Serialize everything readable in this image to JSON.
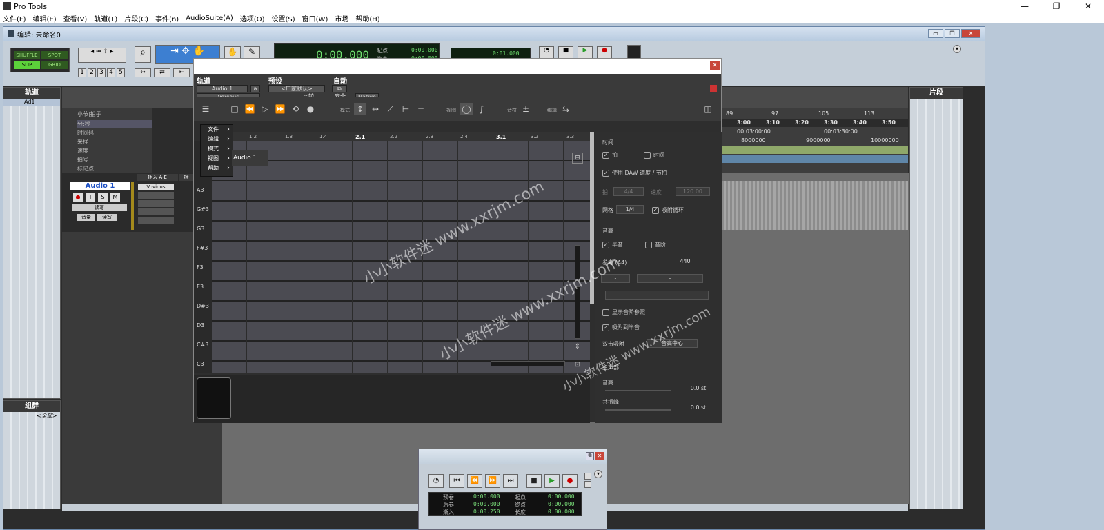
{
  "os": {
    "app_title": "Pro Tools",
    "window_controls": [
      "—",
      "❐",
      "✕"
    ]
  },
  "menu": [
    "文件(F)",
    "编辑(E)",
    "查看(V)",
    "轨道(T)",
    "片段(C)",
    "事件(n)",
    "AudioSuite(A)",
    "选项(O)",
    "设置(S)",
    "窗口(W)",
    "市场",
    "帮助(H)"
  ],
  "edit_window": {
    "title": "编辑: 未命名0",
    "modes": {
      "shuffle": "SHUFFLE",
      "spot": "SPOT",
      "slip": "SLIP",
      "grid": "GRID"
    },
    "zoom_presets": [
      "1",
      "2",
      "3",
      "4",
      "5"
    ],
    "counter_main": "0:00.000",
    "counter_start_label": "起点",
    "counter_start": "0:00.000",
    "counter_end_label": "终点",
    "counter_end": "0:00.000",
    "small_counter": "0:01.000"
  },
  "tracks_panel": {
    "title": "轨道",
    "items": [
      "Ad1"
    ]
  },
  "groups_panel": {
    "title": "组群",
    "items": [
      "<全部>"
    ]
  },
  "clips_panel": {
    "title": "片段"
  },
  "rulers": [
    "小节|拍子",
    "分:秒",
    "时间码",
    "采样",
    "速度",
    "拍号",
    "标记点"
  ],
  "ruler_bars": [
    "89",
    "97",
    "105",
    "113"
  ],
  "ruler_minsec": [
    "3:00",
    "3:10",
    "3:20",
    "3:30",
    "3:40",
    "3:50"
  ],
  "ruler_timecode": [
    "00:03:00:00",
    "00:03:30:00"
  ],
  "ruler_samples": [
    "8000000",
    "9000000",
    "10000000"
  ],
  "track": {
    "name": "Audio 1",
    "buttons": [
      "●",
      "I",
      "S",
      "M"
    ],
    "mode_read": "读写",
    "vol_label": "音量",
    "read_label": "读写",
    "insert_header": "插入 A-E",
    "insert_header2": "插",
    "insert_plugin": "Vovious"
  },
  "plugin": {
    "section_track": "轨道",
    "section_preset": "预设",
    "section_auto": "自动",
    "track_select": "Audio 1",
    "track_letter": "a",
    "plugin_name": "Vovious",
    "preset_select": "<厂家默认>",
    "compare": "比较",
    "safe": "安全",
    "native": "Native",
    "toolbar_labels": {
      "mode": "模式",
      "view": "视图",
      "pitch": "音符",
      "edit": "编辑"
    },
    "menu_items": [
      "文件",
      "编辑",
      "模式",
      "视图",
      "帮助"
    ],
    "audio_tab": "Audio 1",
    "ruler_marks": [
      "1.2",
      "1.3",
      "1.4",
      "2.1",
      "2.2",
      "2.3",
      "2.4",
      "3.1",
      "3.2",
      "3.3"
    ],
    "keys": [
      "A3",
      "G#3",
      "G3",
      "F#3",
      "F3",
      "E3",
      "D#3",
      "D3",
      "C#3",
      "C3"
    ],
    "inspector": {
      "time_title": "时间",
      "beat": "拍",
      "time": "时间",
      "use_daw": "使用 DAW 速度 / 节拍",
      "sig_label": "拍",
      "sig_value": "4/4",
      "tempo_label": "速度",
      "tempo_value": "120.00",
      "grid_label": "网格",
      "grid_value": "1/4",
      "snap_loop": "吸附循环",
      "pitch_title": "音高",
      "semitone": "半音",
      "scale": "音阶",
      "ref_label": "参考 (A4)",
      "ref_value": "440",
      "dash1": "-",
      "dash2": "-",
      "show_scale": "显示音阶参照",
      "snap_semitone": "吸附到半音",
      "click_snap": "双击吸附",
      "click_snap_value": "音高中心",
      "main_title": "主声部",
      "pitch_label": "音高",
      "pitch_value": "0.0 st",
      "formant_label": "共振峰",
      "formant_value": "0.0 st"
    }
  },
  "transport": {
    "rows": [
      {
        "l": "预卷",
        "v1": "0:00.000",
        "r": "起点",
        "v2": "0:00.000"
      },
      {
        "l": "后卷",
        "v1": "0:00.000",
        "r": "终点",
        "v2": "0:00.000"
      },
      {
        "l": "渐入",
        "v1": "0:00.250",
        "r": "长度",
        "v2": "0:00.000"
      }
    ]
  },
  "watermark": [
    "小小软件迷 www.xxrjm.com",
    "小小软件迷 www.xxrjm.com",
    "小小软件迷 www.xxrjm.com"
  ]
}
